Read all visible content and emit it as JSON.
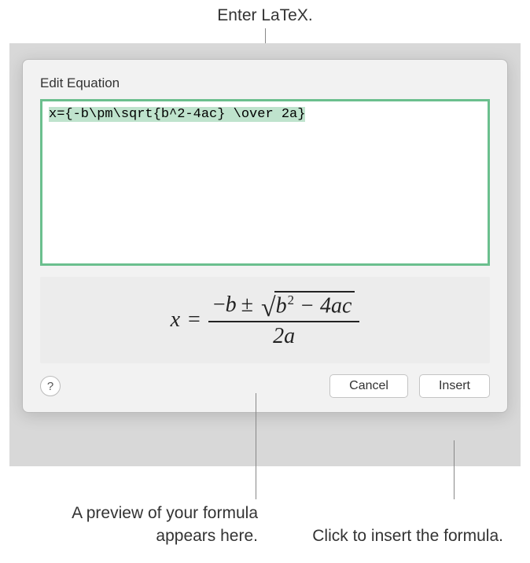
{
  "callouts": {
    "top": "Enter LaTeX.",
    "bottomLeft": "A preview of your formula appears here.",
    "bottomRight": "Click to insert the formula."
  },
  "dialog": {
    "title": "Edit Equation",
    "latexInput": "x={-b\\pm\\sqrt{b^2-4ac} \\over 2a}",
    "helpLabel": "?",
    "cancelLabel": "Cancel",
    "insertLabel": "Insert"
  },
  "formula": {
    "lhs": "x",
    "equals": "=",
    "minus": "−",
    "b": "b",
    "pm": "±",
    "sqrtInner_b": "b",
    "sqrtInner_exp": "2",
    "sqrtInner_rest": " − 4ac",
    "den": "2a"
  }
}
